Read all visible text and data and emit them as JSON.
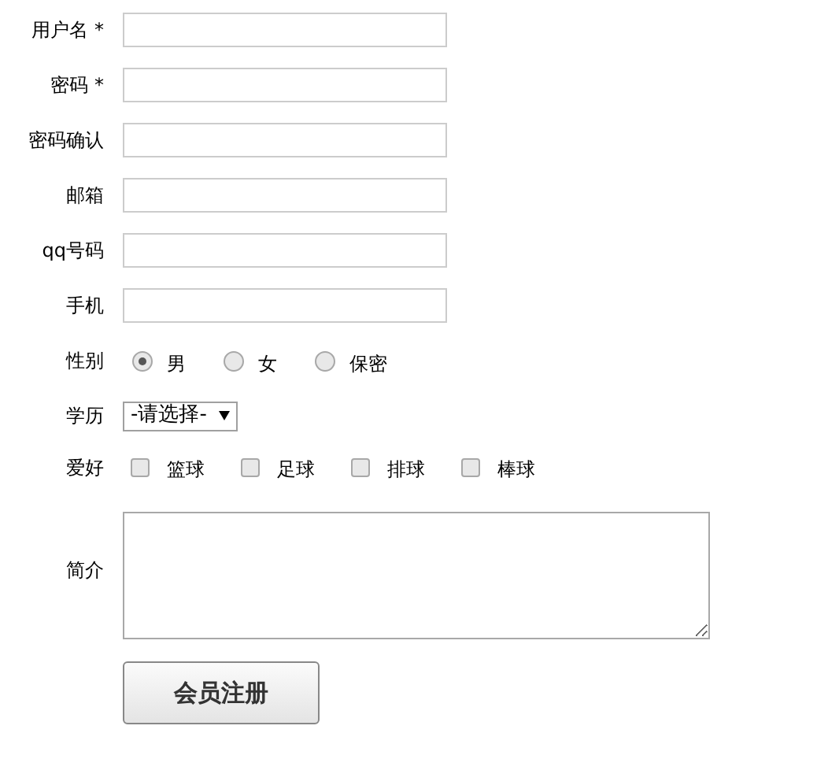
{
  "rows": [
    {
      "kind": "text",
      "label": "用户名 *"
    },
    {
      "kind": "text",
      "label": "密码 *"
    },
    {
      "kind": "text",
      "label": "密码确认"
    },
    {
      "kind": "text",
      "label": "邮箱"
    },
    {
      "kind": "text",
      "label": "qq号码"
    },
    {
      "kind": "text",
      "label": "手机"
    },
    {
      "kind": "radio",
      "label": "性别",
      "options": [
        {
          "label": "男",
          "selected": true
        },
        {
          "label": "女",
          "selected": false
        },
        {
          "label": "保密",
          "selected": false
        }
      ]
    },
    {
      "kind": "select",
      "label": "学历",
      "value": "-请选择-"
    },
    {
      "kind": "checkbox",
      "label": "爱好",
      "options": [
        {
          "label": "篮球",
          "checked": false
        },
        {
          "label": "足球",
          "checked": false
        },
        {
          "label": "排球",
          "checked": false
        },
        {
          "label": "棒球",
          "checked": false
        }
      ]
    },
    {
      "kind": "textarea",
      "label": "简介"
    }
  ],
  "submit": "会员注册"
}
